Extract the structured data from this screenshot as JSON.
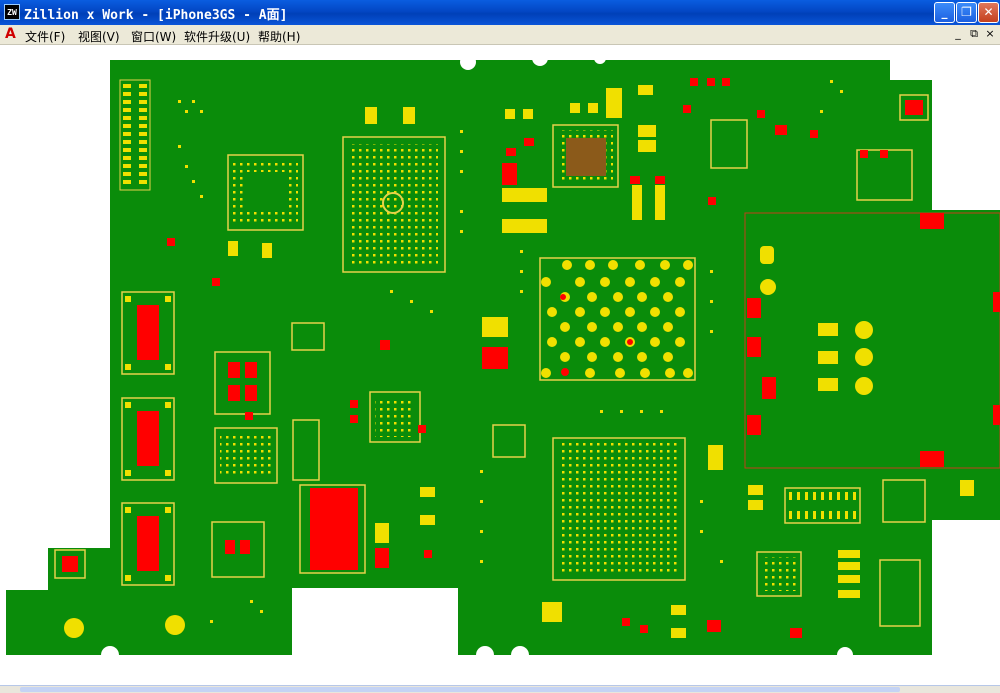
{
  "window": {
    "app_icon": "ZW",
    "title": "Zillion x Work - [iPhone3GS - A面]",
    "minimize": "minimize-icon",
    "maximize": "restore-icon",
    "close": "close-icon"
  },
  "menubar": {
    "doc_icon": "A",
    "items": [
      "文件(F)",
      "视图(V)",
      "窗口(W)",
      "软件升级(U)",
      "帮助(H)"
    ],
    "mdi_controls": [
      "_",
      "⧉",
      "×"
    ]
  },
  "board": {
    "name": "iPhone3GS",
    "side": "A面",
    "colors": {
      "pcb": "#0a8c0a",
      "pad": "#f0e000",
      "pin": "#ff0000",
      "outline": "#e6d24a"
    }
  }
}
